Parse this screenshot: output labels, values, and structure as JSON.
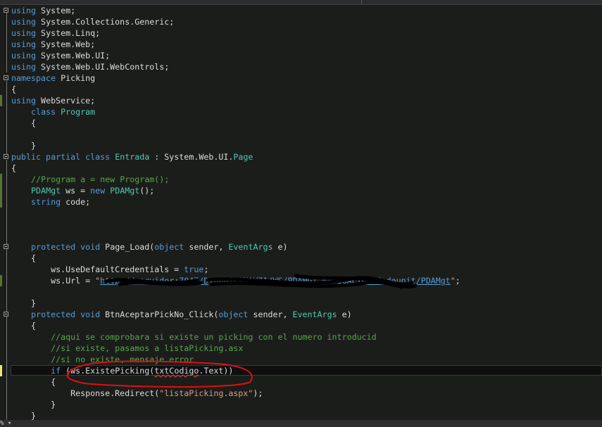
{
  "editor": {
    "zoom_level": "%",
    "lines": [
      [
        [
          "using",
          "kw"
        ],
        [
          " System;",
          "pl"
        ]
      ],
      [
        [
          "using",
          "kw"
        ],
        [
          " System.Collections.Generic;",
          "pl"
        ]
      ],
      [
        [
          "using",
          "kw"
        ],
        [
          " System.Linq;",
          "pl"
        ]
      ],
      [
        [
          "using",
          "kw"
        ],
        [
          " System.Web;",
          "pl"
        ]
      ],
      [
        [
          "using",
          "kw"
        ],
        [
          " System.Web.UI;",
          "pl"
        ]
      ],
      [
        [
          "using",
          "kw"
        ],
        [
          " System.Web.UI.WebControls;",
          "pl"
        ]
      ],
      [
        [
          "namespace",
          "kw"
        ],
        [
          " Picking",
          "pl"
        ]
      ],
      [
        [
          "{",
          "pl"
        ]
      ],
      [
        [
          "using",
          "kw"
        ],
        [
          " WebService;",
          "pl"
        ]
      ],
      [
        [
          "    ",
          "pl"
        ],
        [
          "class",
          "kw"
        ],
        [
          " ",
          "pl"
        ],
        [
          "Program",
          "ty"
        ]
      ],
      [
        [
          "    {",
          "pl"
        ]
      ],
      [],
      [
        [
          "    }",
          "pl"
        ]
      ],
      [
        [
          "public partial class",
          "kw"
        ],
        [
          " ",
          "pl"
        ],
        [
          "Entrada",
          "ty"
        ],
        [
          " : System.Web.UI.",
          "pl"
        ],
        [
          "Page",
          "ty"
        ]
      ],
      [
        [
          "{",
          "pl"
        ]
      ],
      [
        [
          "    ",
          "pl"
        ],
        [
          "//Program a = new Program();",
          "cm"
        ]
      ],
      [
        [
          "    ",
          "pl"
        ],
        [
          "PDAMgt",
          "ty"
        ],
        [
          " ws = ",
          "pl"
        ],
        [
          "new",
          "kw"
        ],
        [
          " ",
          "pl"
        ],
        [
          "PDAMgt",
          "ty"
        ],
        [
          "();",
          "pl"
        ]
      ],
      [
        [
          "    ",
          "pl"
        ],
        [
          "string",
          "kw"
        ],
        [
          " code;",
          "pl"
        ]
      ],
      [],
      [],
      [],
      [
        [
          "    ",
          "pl"
        ],
        [
          "protected void",
          "kw"
        ],
        [
          " Page_Load(",
          "pl"
        ],
        [
          "object",
          "kw"
        ],
        [
          " sender, ",
          "pl"
        ],
        [
          "EventArgs",
          "ty"
        ],
        [
          " e)",
          "pl"
        ]
      ],
      [
        [
          "    {",
          "pl"
        ]
      ],
      [
        [
          "        ws.UseDefaultCredentials = ",
          "pl"
        ],
        [
          "true",
          "kw"
        ],
        [
          ";",
          "pl"
        ]
      ],
      [
        [
          "        ws.Url = ",
          "pl"
        ],
        [
          "\"",
          "st"
        ],
        [
          "http://servidor:7047/DynamicsNAV71/WS/PDAMGT NAVEGACION/Codeunit/PDAMgt",
          "url"
        ],
        [
          "\"",
          "st"
        ],
        [
          ";",
          "pl"
        ]
      ],
      [],
      [
        [
          "    }",
          "pl"
        ]
      ],
      [
        [
          "    ",
          "pl"
        ],
        [
          "protected void",
          "kw"
        ],
        [
          " BtnAceptarPickNo_Click(",
          "pl"
        ],
        [
          "object",
          "kw"
        ],
        [
          " sender, ",
          "pl"
        ],
        [
          "EventArgs",
          "ty"
        ],
        [
          " e)",
          "pl"
        ]
      ],
      [
        [
          "    {",
          "pl"
        ]
      ],
      [
        [
          "        ",
          "pl"
        ],
        [
          "//aqui se comprobara si existe un picking con el numero introducid",
          "cm"
        ]
      ],
      [
        [
          "        ",
          "pl"
        ],
        [
          "//si existe, pasamos a listaPicking.asx",
          "cm"
        ]
      ],
      [
        [
          "        ",
          "pl"
        ],
        [
          "//si no existe, mensaje error",
          "cm"
        ]
      ],
      [
        [
          "        ",
          "pl"
        ],
        [
          "if",
          "kw"
        ],
        [
          " (ws.ExistePicking(",
          "pl"
        ],
        [
          "txtCodigo",
          "squig"
        ],
        [
          ".Text))",
          "pl"
        ]
      ],
      [
        [
          "        {",
          "pl"
        ]
      ],
      [
        [
          "            Response.Redirect(",
          "pl"
        ],
        [
          "\"listaPicking.aspx\"",
          "st"
        ],
        [
          ");",
          "pl"
        ]
      ],
      [
        [
          "        }",
          "pl"
        ]
      ],
      [
        [
          "    }",
          "pl"
        ]
      ]
    ],
    "current_line": 32,
    "collapse_lines": [
      0,
      6,
      13,
      21,
      27
    ],
    "changed_lines": [
      8,
      15,
      16,
      17,
      24,
      32
    ],
    "unsaved_lines": [
      32
    ],
    "annotation_color": "#e01010"
  }
}
